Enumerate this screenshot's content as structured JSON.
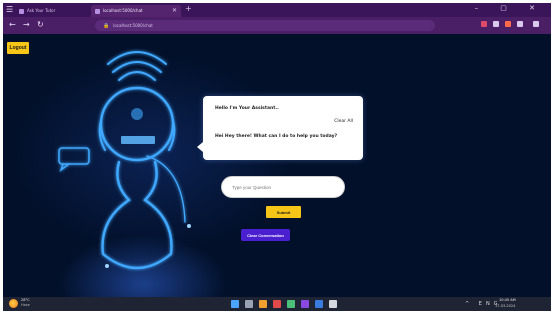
{
  "browser": {
    "tabs": [
      {
        "label": "Ask Your Tutor"
      },
      {
        "label": "localhost:5000/chat"
      }
    ],
    "new_tab": "+",
    "window_controls": "– ▢ ✕",
    "url": "localhost:5000/chat",
    "nav": {
      "back": "←",
      "forward": "→",
      "reload": "↻"
    }
  },
  "page": {
    "logout_label": "Logout",
    "chat": {
      "greeting": "Hello I'm Your Assistant..",
      "clear_label": "Clear All",
      "question": "Hei Hey there! What can I do to help you today?"
    },
    "input_placeholder": "Type your Question",
    "submit_label": "Submit",
    "clear_conversation_label": "Clear Conversation"
  },
  "taskbar": {
    "weather_temp": "28°C",
    "weather_desc": "Haze",
    "tray": "^ ENG",
    "time": "10:45 AM",
    "date": "17-03-2024"
  },
  "colors": {
    "page_bg": "#02102a",
    "accent_yellow": "#f5c518",
    "accent_blue": "#4a1fd0",
    "browser_purple": "#3b1559",
    "robot_glow": "#3fa9ff"
  }
}
